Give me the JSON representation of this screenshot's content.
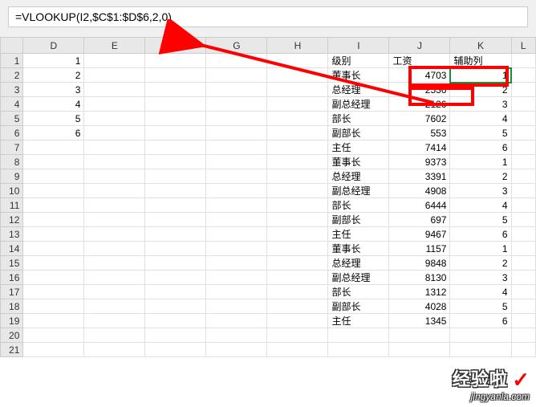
{
  "formula": "=VLOOKUP(I2,$C$1:$D$6,2,0)",
  "columns": [
    "D",
    "E",
    "F",
    "G",
    "H",
    "I",
    "J",
    "K",
    "L"
  ],
  "header_row": {
    "I": "级别",
    "J": "工资",
    "K": "辅助列"
  },
  "col_d_values": [
    "1",
    "2",
    "3",
    "4",
    "5",
    "6"
  ],
  "rows": [
    {
      "i": "董事长",
      "j": "4703",
      "k": "1"
    },
    {
      "i": "总经理",
      "j": "2536",
      "k": "2"
    },
    {
      "i": "副总经理",
      "j": "2126",
      "k": "3"
    },
    {
      "i": "部长",
      "j": "7602",
      "k": "4"
    },
    {
      "i": "副部长",
      "j": "553",
      "k": "5"
    },
    {
      "i": "主任",
      "j": "7414",
      "k": "6"
    },
    {
      "i": "董事长",
      "j": "9373",
      "k": "1"
    },
    {
      "i": "总经理",
      "j": "3391",
      "k": "2"
    },
    {
      "i": "副总经理",
      "j": "4908",
      "k": "3"
    },
    {
      "i": "部长",
      "j": "6444",
      "k": "4"
    },
    {
      "i": "副部长",
      "j": "697",
      "k": "5"
    },
    {
      "i": "主任",
      "j": "9467",
      "k": "6"
    },
    {
      "i": "董事长",
      "j": "1157",
      "k": "1"
    },
    {
      "i": "总经理",
      "j": "9848",
      "k": "2"
    },
    {
      "i": "副总经理",
      "j": "8130",
      "k": "3"
    },
    {
      "i": "部长",
      "j": "1312",
      "k": "4"
    },
    {
      "i": "副部长",
      "j": "4028",
      "k": "5"
    },
    {
      "i": "主任",
      "j": "1345",
      "k": "6"
    }
  ],
  "annotation": {
    "arrow_color": "#ff0000",
    "box_color": "#ff0000"
  },
  "watermark": {
    "main": "经验啦",
    "sub": "jingyanla.com"
  }
}
